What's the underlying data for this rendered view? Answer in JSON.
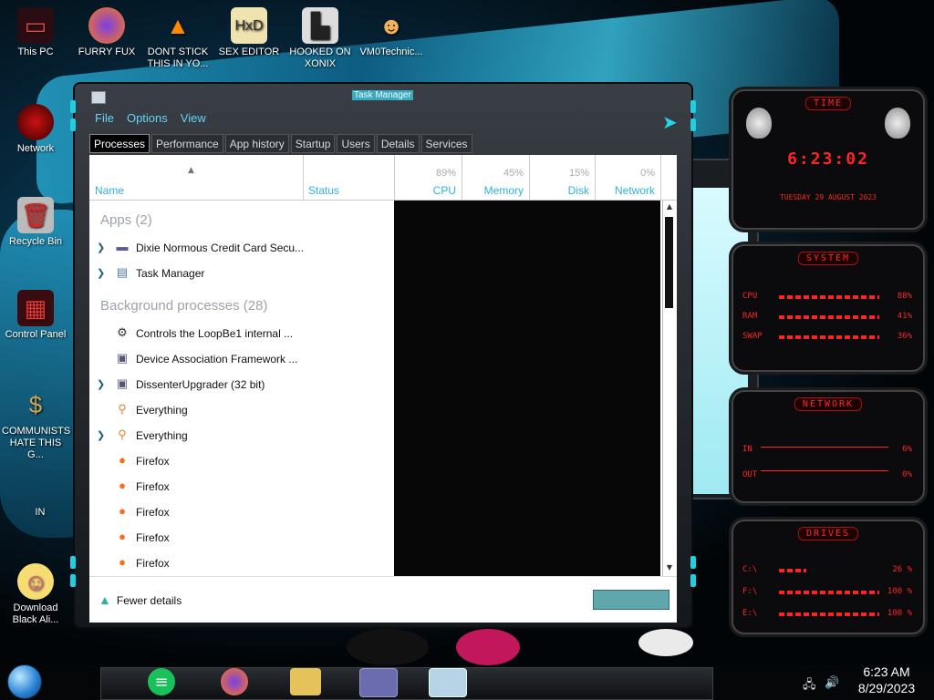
{
  "desktop": {
    "icons": [
      {
        "label": "This PC",
        "icon": "computer-icon"
      },
      {
        "label": "FURRY FUX",
        "icon": "firefox-icon"
      },
      {
        "label": "DONT STICK THIS IN YO...",
        "icon": "vlc-cone-icon"
      },
      {
        "label": "SEX EDITOR",
        "icon": "hex-editor-icon"
      },
      {
        "label": "HOOKED ON XONIX",
        "icon": "xonix-icon"
      },
      {
        "label": "VM0Technic...",
        "icon": "person-icon"
      },
      {
        "label": "Network",
        "icon": "network-icon"
      },
      {
        "label": "Recycle Bin",
        "icon": "recycle-bin-icon"
      },
      {
        "label": "Control Panel",
        "icon": "control-panel-icon"
      },
      {
        "label": "COMMUNISTS HATE THIS G...",
        "icon": "money-bag-icon"
      },
      {
        "label": "IN",
        "icon": "shortcut-icon"
      },
      {
        "label": "Download Black Ali...",
        "icon": "cartoon-icon"
      }
    ]
  },
  "task_manager": {
    "title": "Task Manager",
    "menu": [
      "File",
      "Options",
      "View"
    ],
    "tabs": [
      "Processes",
      "Performance",
      "App history",
      "Startup",
      "Users",
      "Details",
      "Services"
    ],
    "active_tab": "Processes",
    "columns": {
      "name": "Name",
      "status": "Status",
      "cpu": {
        "label": "CPU",
        "pct": "89%"
      },
      "memory": {
        "label": "Memory",
        "pct": "45%"
      },
      "disk": {
        "label": "Disk",
        "pct": "15%"
      },
      "network": {
        "label": "Network",
        "pct": "0%"
      }
    },
    "groups": {
      "apps": "Apps (2)",
      "background": "Background processes (28)"
    },
    "apps": [
      {
        "name": "Dixie Normous Credit Card Secu...",
        "icon": "card-icon",
        "expandable": true
      },
      {
        "name": "Task Manager",
        "icon": "task-manager-icon",
        "expandable": true
      }
    ],
    "background": [
      {
        "name": "Controls the LoopBe1 internal ...",
        "icon": "gear-icon",
        "expandable": false
      },
      {
        "name": "Device Association Framework ...",
        "icon": "window-icon",
        "expandable": false
      },
      {
        "name": "DissenterUpgrader (32 bit)",
        "icon": "window-icon",
        "expandable": true
      },
      {
        "name": "Everything",
        "icon": "magnifier-icon",
        "expandable": false
      },
      {
        "name": "Everything",
        "icon": "magnifier-icon",
        "expandable": true
      },
      {
        "name": "Firefox",
        "icon": "firefox-icon",
        "expandable": false
      },
      {
        "name": "Firefox",
        "icon": "firefox-icon",
        "expandable": false
      },
      {
        "name": "Firefox",
        "icon": "firefox-icon",
        "expandable": false
      },
      {
        "name": "Firefox",
        "icon": "firefox-icon",
        "expandable": false
      },
      {
        "name": "Firefox",
        "icon": "firefox-icon",
        "expandable": false
      }
    ],
    "fewer_details": "Fewer details"
  },
  "gadget": {
    "time_title": "TIME",
    "time": "6:23:02",
    "date": "TUESDAY 29 AUGUST 2023",
    "system_title": "SYSTEM",
    "system": [
      {
        "key": "CPU",
        "value": "88%",
        "level": 88
      },
      {
        "key": "RAM",
        "value": "41%",
        "level": 41
      },
      {
        "key": "SWAP",
        "value": "36%",
        "level": 36
      }
    ],
    "network_title": "NETWORK",
    "network": [
      {
        "key": "IN",
        "value": "6%"
      },
      {
        "key": "OUT",
        "value": "0%"
      }
    ],
    "drives_title": "DRIVES",
    "drives": [
      {
        "key": "C:\\",
        "value": "26 %",
        "level": 26
      },
      {
        "key": "F:\\",
        "value": "100 %",
        "level": 100
      },
      {
        "key": "E:\\",
        "value": "100 %",
        "level": 100
      }
    ]
  },
  "taskbar": {
    "clock_time": "6:23 AM",
    "clock_date": "8/29/2023"
  },
  "colors": {
    "accent": "#1fd0e0",
    "gadget_red": "#ff2424",
    "link": "#2fb0e6"
  }
}
